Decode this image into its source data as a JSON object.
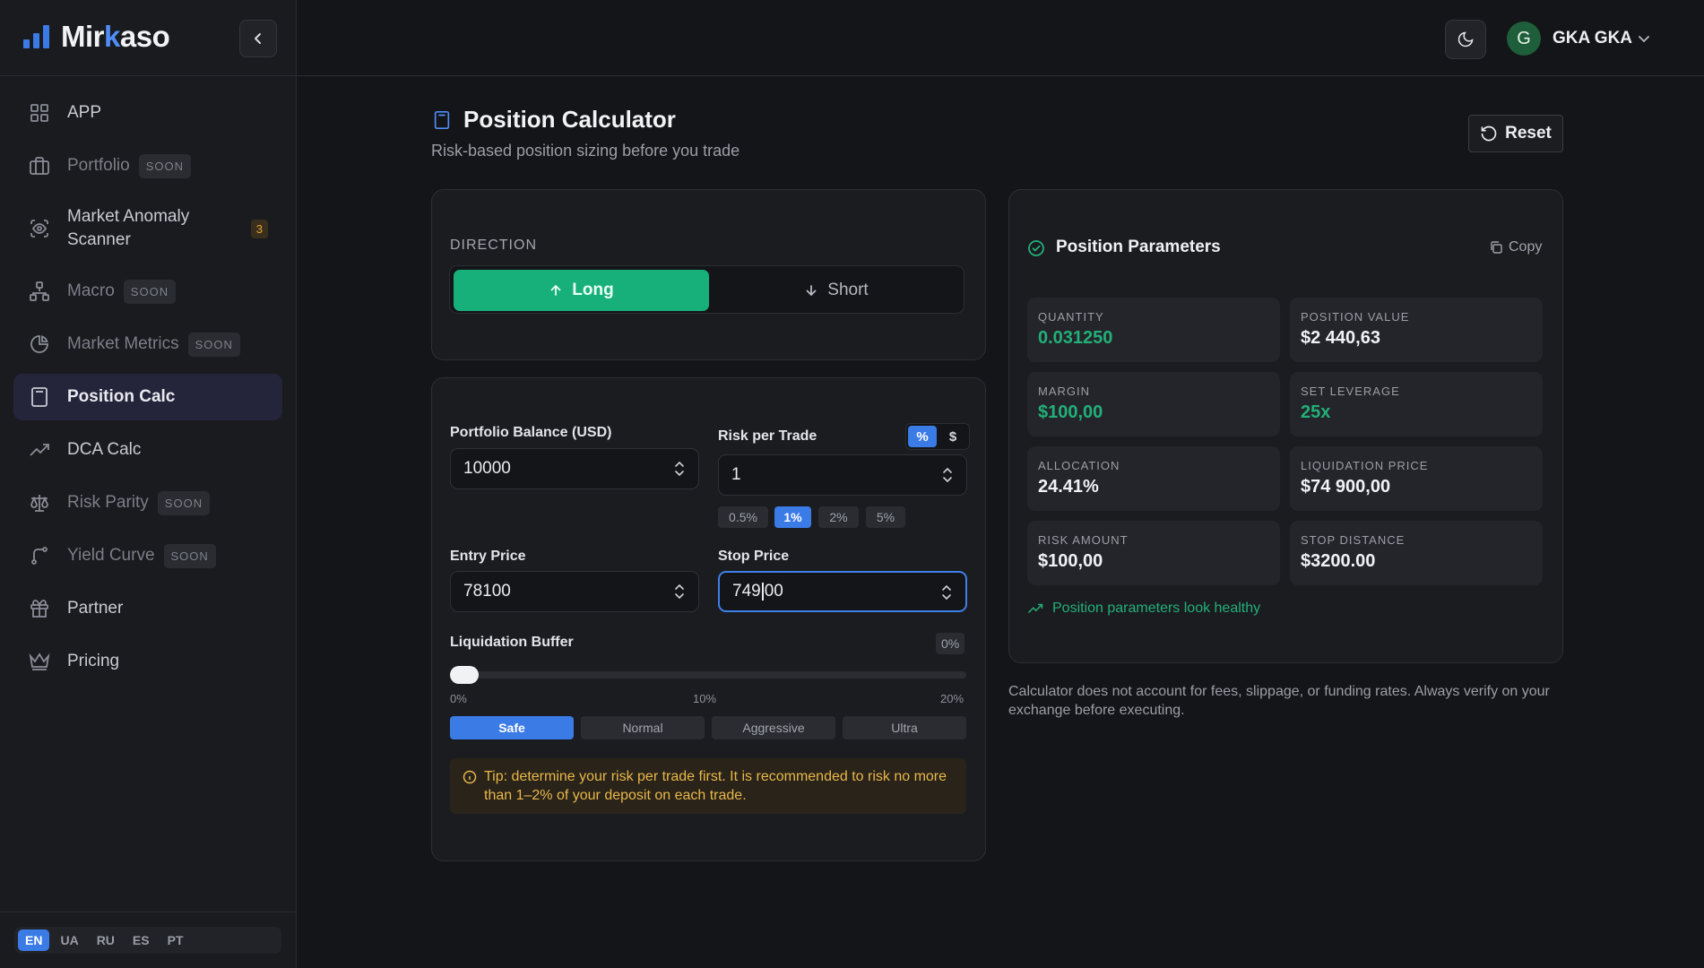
{
  "brand": {
    "name_a": "Mir",
    "name_k": "k",
    "name_b": "aso",
    "accent": "#4f8df7"
  },
  "sidebar": {
    "items": [
      {
        "label": "APP",
        "icon": "grid-icon"
      },
      {
        "label": "Portfolio",
        "icon": "briefcase-icon",
        "soon": "SOON"
      },
      {
        "label": "Market Anomaly Scanner",
        "icon": "scan-eye-icon",
        "badge": "3"
      },
      {
        "label": "Macro",
        "icon": "network-icon",
        "soon": "SOON"
      },
      {
        "label": "Market Metrics",
        "icon": "pie-chart-icon",
        "soon": "SOON"
      },
      {
        "label": "Position Calc",
        "icon": "calculator-icon"
      },
      {
        "label": "DCA Calc",
        "icon": "trending-up-icon"
      },
      {
        "label": "Risk Parity",
        "icon": "scale-icon",
        "soon": "SOON"
      },
      {
        "label": "Yield Curve",
        "icon": "curve-icon",
        "soon": "SOON"
      },
      {
        "label": "Partner",
        "icon": "gift-icon"
      },
      {
        "label": "Pricing",
        "icon": "crown-icon"
      }
    ],
    "languages": [
      "EN",
      "UA",
      "RU",
      "ES",
      "PT"
    ]
  },
  "topbar": {
    "avatar_letter": "G",
    "user_name": "GKA GKA"
  },
  "header": {
    "title": "Position Calculator",
    "subtitle": "Risk-based position sizing before you trade",
    "reset_label": "Reset"
  },
  "direction": {
    "label": "DIRECTION",
    "long": "Long",
    "short": "Short",
    "selected": "Long"
  },
  "form": {
    "balance_label": "Portfolio Balance (USD)",
    "balance_value": "10000",
    "risk_label": "Risk per Trade",
    "risk_value": "1",
    "risk_units": [
      "%",
      "$"
    ],
    "risk_presets": [
      "0.5%",
      "1%",
      "2%",
      "5%"
    ],
    "entry_label": "Entry Price",
    "entry_value": "78100",
    "stop_label": "Stop Price",
    "stop_value_a": "749",
    "stop_value_b": "00",
    "buffer_label": "Liquidation Buffer",
    "buffer_value": "0%",
    "buffer_level": 0,
    "buffer_ticks": [
      "0%",
      "10%",
      "20%"
    ],
    "modes": [
      "Safe",
      "Normal",
      "Aggressive",
      "Ultra"
    ],
    "tip": "Tip: determine your risk per trade first. It is recommended to risk no more than 1–2% of your deposit on each trade."
  },
  "results": {
    "title": "Position Parameters",
    "copy_label": "Copy",
    "metrics": [
      {
        "label": "QUANTITY",
        "value": "0.031250",
        "green": true
      },
      {
        "label": "POSITION VALUE",
        "value": "$2 440,63",
        "green": false
      },
      {
        "label": "MARGIN",
        "value": "$100,00",
        "green": true
      },
      {
        "label": "SET LEVERAGE",
        "value": "25x",
        "green": true
      },
      {
        "label": "ALLOCATION",
        "value": "24.41%",
        "green": false
      },
      {
        "label": "LIQUIDATION PRICE",
        "value": "$74 900,00",
        "green": false
      },
      {
        "label": "RISK AMOUNT",
        "value": "$100,00",
        "green": false
      },
      {
        "label": "STOP DISTANCE",
        "value": "$3200.00",
        "green": false
      }
    ],
    "status": "Position parameters look healthy"
  },
  "disclaimer": "Calculator does not account for fees, slippage, or funding rates. Always verify on your exchange before executing.",
  "colors": {
    "primary": "#3b7be6",
    "success": "#18b07a",
    "warning": "#e8b84a"
  }
}
